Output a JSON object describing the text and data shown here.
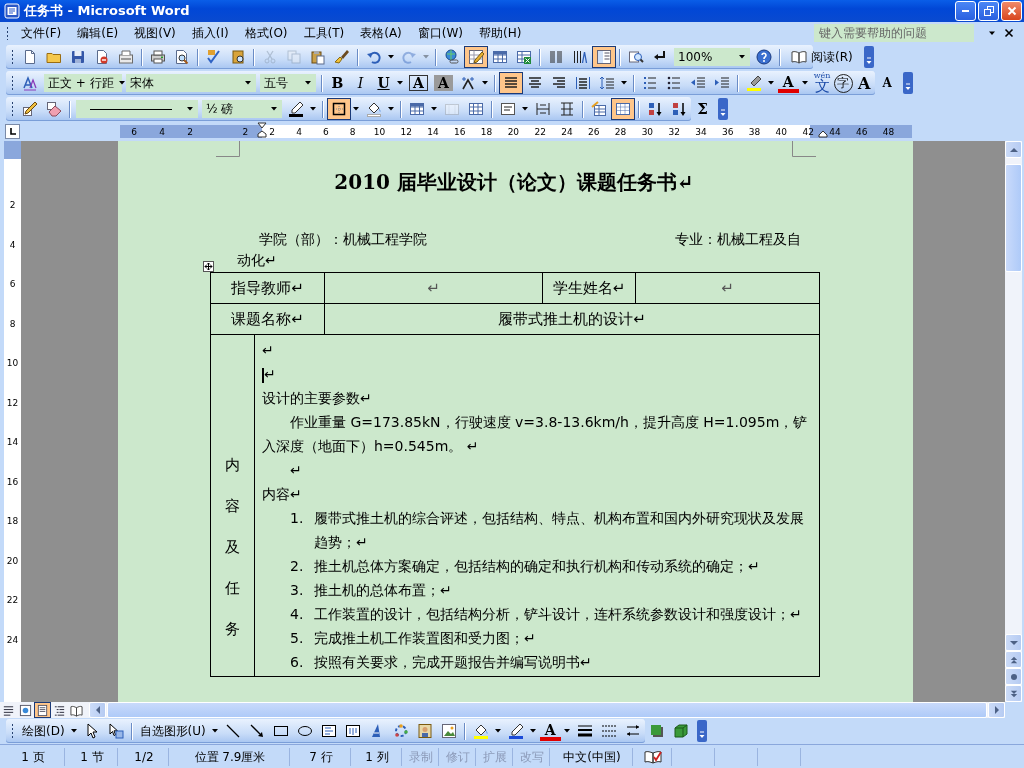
{
  "window": {
    "title": "任务书 - Microsoft Word"
  },
  "menu_bar": {
    "items": [
      {
        "label": "文件(F)"
      },
      {
        "label": "编辑(E)"
      },
      {
        "label": "视图(V)"
      },
      {
        "label": "插入(I)"
      },
      {
        "label": "格式(O)"
      },
      {
        "label": "工具(T)"
      },
      {
        "label": "表格(A)"
      },
      {
        "label": "窗口(W)"
      },
      {
        "label": "帮助(H)"
      }
    ],
    "help_box": {
      "placeholder": "键入需要帮助的问题"
    }
  },
  "standard_toolbar": {
    "items": [
      {
        "kind": "button",
        "pressed": false,
        "disabled": false
      },
      {
        "kind": "button",
        "pressed": false,
        "disabled": false
      },
      {
        "kind": "button",
        "pressed": false,
        "disabled": false
      },
      {
        "kind": "button",
        "pressed": false,
        "disabled": false
      },
      {
        "kind": "button",
        "pressed": false,
        "disabled": false
      },
      {
        "kind": "separator"
      },
      {
        "kind": "button",
        "pressed": false,
        "disabled": false
      },
      {
        "kind": "button",
        "pressed": false,
        "disabled": false
      },
      {
        "kind": "separator"
      },
      {
        "kind": "button",
        "pressed": false,
        "disabled": false
      },
      {
        "kind": "button",
        "pressed": false,
        "disabled": false
      },
      {
        "kind": "separator"
      },
      {
        "kind": "button",
        "pressed": false,
        "disabled": true
      },
      {
        "kind": "button",
        "pressed": false,
        "disabled": true
      },
      {
        "kind": "button",
        "pressed": false,
        "disabled": false
      },
      {
        "kind": "button",
        "pressed": false,
        "disabled": false
      },
      {
        "kind": "separator"
      },
      {
        "kind": "button",
        "pressed": false,
        "disabled": false
      },
      {
        "kind": "arrow",
        "disabled": false
      },
      {
        "kind": "button",
        "pressed": false,
        "disabled": true
      },
      {
        "kind": "arrow",
        "disabled": true
      },
      {
        "kind": "separator"
      },
      {
        "kind": "button",
        "pressed": false,
        "disabled": false
      },
      {
        "kind": "button",
        "pressed": true,
        "disabled": false
      },
      {
        "kind": "button",
        "pressed": false,
        "disabled": false
      },
      {
        "kind": "button",
        "pressed": false,
        "disabled": false
      },
      {
        "kind": "separator"
      },
      {
        "kind": "button",
        "pressed": false,
        "disabled": false
      },
      {
        "kind": "button",
        "pressed": false,
        "disabled": false
      },
      {
        "kind": "button",
        "pressed": true,
        "disabled": false
      },
      {
        "kind": "separator"
      },
      {
        "kind": "button",
        "pressed": false,
        "disabled": false
      },
      {
        "kind": "button",
        "pressed": false,
        "disabled": false
      },
      {
        "kind": "combo",
        "value": "100%"
      },
      {
        "kind": "button",
        "pressed": false,
        "disabled": false
      },
      {
        "kind": "separator"
      },
      {
        "kind": "label-button",
        "label": "阅读(R)"
      }
    ]
  },
  "formatting_toolbar": {
    "items": [
      {
        "kind": "button",
        "pressed": false,
        "disabled": false
      },
      {
        "kind": "combo",
        "value": "正文 + 行距"
      },
      {
        "kind": "combo",
        "value": "宋体"
      },
      {
        "kind": "combo",
        "value": "五号"
      },
      {
        "kind": "separator"
      },
      {
        "kind": "bold",
        "label": "B",
        "pressed": false
      },
      {
        "kind": "italic",
        "label": "I",
        "pressed": false
      },
      {
        "kind": "underline",
        "label": "U",
        "pressed": false
      },
      {
        "kind": "arrow",
        "disabled": false
      },
      {
        "kind": "boxed",
        "label": "A",
        "pressed": false
      },
      {
        "kind": "shaded",
        "label": "A",
        "pressed": false
      },
      {
        "kind": "button",
        "pressed": false,
        "disabled": false
      },
      {
        "kind": "arrow",
        "disabled": false
      },
      {
        "kind": "separator"
      },
      {
        "kind": "button",
        "pressed": true,
        "disabled": false
      },
      {
        "kind": "button",
        "pressed": false,
        "disabled": false
      },
      {
        "kind": "button",
        "pressed": false,
        "disabled": false
      },
      {
        "kind": "button",
        "pressed": false,
        "disabled": false
      },
      {
        "kind": "button",
        "pressed": false,
        "disabled": false
      },
      {
        "kind": "arrow",
        "disabled": false
      },
      {
        "kind": "separator"
      },
      {
        "kind": "button",
        "pressed": false,
        "disabled": false
      },
      {
        "kind": "button",
        "pressed": false,
        "disabled": false
      },
      {
        "kind": "button",
        "pressed": false,
        "disabled": false
      },
      {
        "kind": "button",
        "pressed": false,
        "disabled": false
      },
      {
        "kind": "separator"
      },
      {
        "kind": "button",
        "pressed": false,
        "disabled": false
      },
      {
        "kind": "arrow",
        "disabled": false
      },
      {
        "kind": "fontcolor",
        "label": "A",
        "pressed": false
      },
      {
        "kind": "arrow",
        "disabled": false
      },
      {
        "kind": "phonetic",
        "label": "文",
        "ruby": "wén",
        "pressed": false
      },
      {
        "kind": "circled",
        "label": "字",
        "pressed": false
      },
      {
        "kind": "grow",
        "label": "A",
        "pressed": false
      },
      {
        "kind": "shrink",
        "label": "A",
        "pressed": false
      }
    ]
  },
  "tables_toolbar": {
    "items": [
      {
        "kind": "button",
        "pressed": false,
        "disabled": false
      },
      {
        "kind": "button",
        "pressed": false,
        "disabled": false
      },
      {
        "kind": "separator"
      },
      {
        "kind": "line-combo"
      },
      {
        "kind": "combo",
        "value": "½ 磅"
      },
      {
        "kind": "button",
        "pressed": false,
        "disabled": false
      },
      {
        "kind": "arrow",
        "disabled": false
      },
      {
        "kind": "separator"
      },
      {
        "kind": "button",
        "pressed": true,
        "disabled": false
      },
      {
        "kind": "arrow",
        "disabled": false
      },
      {
        "kind": "button",
        "pressed": false,
        "disabled": false
      },
      {
        "kind": "arrow",
        "disabled": false
      },
      {
        "kind": "separator"
      },
      {
        "kind": "button",
        "pressed": false,
        "disabled": false
      },
      {
        "kind": "arrow",
        "disabled": false
      },
      {
        "kind": "button",
        "pressed": false,
        "disabled": true
      },
      {
        "kind": "button",
        "pressed": false,
        "disabled": false
      },
      {
        "kind": "separator"
      },
      {
        "kind": "button",
        "pressed": false,
        "disabled": false
      },
      {
        "kind": "arrow",
        "disabled": false
      },
      {
        "kind": "button",
        "pressed": false,
        "disabled": false
      },
      {
        "kind": "button",
        "pressed": false,
        "disabled": false
      },
      {
        "kind": "separator"
      },
      {
        "kind": "button",
        "pressed": false,
        "disabled": false
      },
      {
        "kind": "button",
        "pressed": true,
        "disabled": false
      },
      {
        "kind": "separator"
      },
      {
        "kind": "button",
        "pressed": false,
        "disabled": false
      },
      {
        "kind": "button",
        "pressed": false,
        "disabled": false
      },
      {
        "kind": "plain",
        "label": "Σ",
        "pressed": false
      }
    ]
  },
  "ruler": {
    "left_labels": [
      "6",
      "4",
      "2"
    ],
    "labels": [
      "2",
      "2",
      "4",
      "6",
      "8",
      "10",
      "12",
      "14",
      "16",
      "18",
      "20",
      "22",
      "24",
      "26",
      "28",
      "30",
      "32",
      "34",
      "36",
      "38",
      "40",
      "42",
      "44",
      "46",
      "48"
    ],
    "vertical_labels": [
      "2",
      "4",
      "6",
      "8",
      "10",
      "12",
      "14",
      "16",
      "18",
      "20",
      "22",
      "24"
    ]
  },
  "document": {
    "title": "2010 届毕业设计（论文）课题任务书↵",
    "college": "学院（部）：机械工程学院",
    "major": "专业：机械工程及自动化↵",
    "supervisor_label": "指导教师↵",
    "supervisor_name": "↵",
    "student_label": "学生姓名↵",
    "student_name": "↵",
    "topic_label": "课题名称↵",
    "topic": "履带式推土机的设计↵",
    "content_label": "内容及任务",
    "content": [
      {
        "kind": "plain",
        "text": "↵"
      },
      {
        "kind": "cursor",
        "text": "↵"
      },
      {
        "kind": "plain",
        "text": "设计的主要参数↵"
      },
      {
        "kind": "indented",
        "text": "作业重量 G=173.85kN，行驶速度 v=3.8-13.6km/h，提升高度 H=1.095m，铲入深度（地面下）h=0.545m。 ↵"
      },
      {
        "kind": "indented",
        "text": "↵"
      },
      {
        "kind": "plain",
        "text": "内容↵"
      },
      {
        "kind": "list-item",
        "number": "1.",
        "text": "履带式推土机的综合评述，包括结构、特点、机构布置和国内外研究现状及发展趋势；↵"
      },
      {
        "kind": "list-item",
        "number": "2.",
        "text": "推土机总体方案确定，包括结构的确定和执行机构和传动系统的确定；↵"
      },
      {
        "kind": "list-item",
        "number": "3.",
        "text": "推土机的总体布置；↵"
      },
      {
        "kind": "list-item",
        "number": "4.",
        "text": "工作装置的设计，包括结构分析，铲斗设计，连杆系统参数设计和强度设计；↵"
      },
      {
        "kind": "list-item",
        "number": "5.",
        "text": "完成推土机工作装置图和受力图；↵"
      },
      {
        "kind": "list-item",
        "number": "6.",
        "text": "按照有关要求，完成开题报告并编写说明书↵"
      }
    ]
  },
  "view_buttons": [
    {
      "pressed": false
    },
    {
      "pressed": false
    },
    {
      "pressed": true
    },
    {
      "pressed": false
    },
    {
      "pressed": false
    }
  ],
  "drawing_toolbar": {
    "items": [
      {
        "kind": "menu",
        "label": "绘图(D)",
        "pressed": false
      },
      {
        "kind": "arrow",
        "disabled": false
      },
      {
        "kind": "button",
        "pressed": false,
        "disabled": false
      },
      {
        "kind": "button",
        "pressed": false,
        "disabled": false
      },
      {
        "kind": "separator"
      },
      {
        "kind": "menu",
        "label": "自选图形(U)",
        "pressed": false
      },
      {
        "kind": "arrow",
        "disabled": false
      },
      {
        "kind": "button",
        "pressed": false,
        "disabled": false
      },
      {
        "kind": "button",
        "pressed": false,
        "disabled": false
      },
      {
        "kind": "button",
        "pressed": false,
        "disabled": false
      },
      {
        "kind": "button",
        "pressed": false,
        "disabled": false
      },
      {
        "kind": "button",
        "pressed": false,
        "disabled": false
      },
      {
        "kind": "button",
        "pressed": false,
        "disabled": false
      },
      {
        "kind": "button",
        "pressed": false,
        "disabled": false
      },
      {
        "kind": "button",
        "pressed": false,
        "disabled": false
      },
      {
        "kind": "button",
        "pressed": false,
        "disabled": false
      },
      {
        "kind": "button",
        "pressed": false,
        "disabled": false
      },
      {
        "kind": "separator"
      },
      {
        "kind": "button",
        "pressed": false,
        "disabled": false
      },
      {
        "kind": "arrow",
        "disabled": false
      },
      {
        "kind": "button",
        "pressed": false,
        "disabled": false
      },
      {
        "kind": "arrow",
        "disabled": false
      },
      {
        "kind": "fontcolor",
        "label": "A",
        "pressed": false
      },
      {
        "kind": "arrow",
        "disabled": false
      },
      {
        "kind": "button",
        "pressed": false,
        "disabled": false
      },
      {
        "kind": "button",
        "pressed": false,
        "disabled": false
      },
      {
        "kind": "button",
        "pressed": false,
        "disabled": false
      },
      {
        "kind": "button",
        "pressed": false,
        "disabled": false
      },
      {
        "kind": "button",
        "pressed": false,
        "disabled": false
      }
    ]
  },
  "status_bar": [
    {
      "text": "1 页",
      "disabled": false
    },
    {
      "text": "1 节",
      "disabled": false
    },
    {
      "text": "1/2",
      "disabled": false
    },
    {
      "text": "位置 7.9厘米",
      "disabled": false
    },
    {
      "text": "7 行",
      "disabled": false
    },
    {
      "text": "1 列",
      "disabled": false
    },
    {
      "text": "录制",
      "disabled": true
    },
    {
      "text": "修订",
      "disabled": true
    },
    {
      "text": "扩展",
      "disabled": true
    },
    {
      "text": "改写",
      "disabled": true
    },
    {
      "text": "中文(中国)",
      "disabled": false
    }
  ]
}
